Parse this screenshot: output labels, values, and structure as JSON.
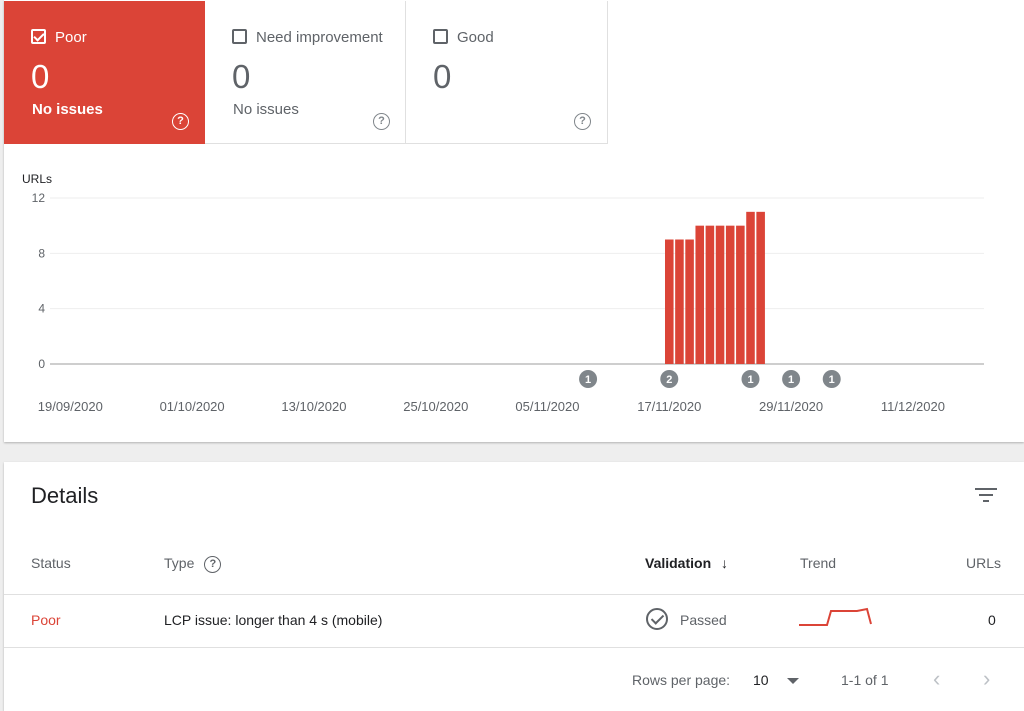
{
  "tiles": {
    "poor": {
      "label": "Poor",
      "count": "0",
      "sub": "No issues",
      "checked": true
    },
    "need": {
      "label": "Need improvement",
      "count": "0",
      "sub": "No issues",
      "checked": false
    },
    "good": {
      "label": "Good",
      "count": "0",
      "sub": "",
      "checked": false
    }
  },
  "help_glyph": "?",
  "colors": {
    "poor": "#db4437",
    "text_secondary": "#5f6368",
    "marker": "#80868b"
  },
  "chart_data": {
    "type": "bar",
    "ylabel": "URLs",
    "ylim": [
      0,
      12
    ],
    "yticks": [
      "12",
      "8",
      "4",
      "0"
    ],
    "x_range": [
      "2020-09-17",
      "2020-12-18"
    ],
    "xtick_labels": [
      "19/09/2020",
      "01/10/2020",
      "13/10/2020",
      "25/10/2020",
      "05/11/2020",
      "17/11/2020",
      "29/11/2020",
      "11/12/2020"
    ],
    "xtick_dates": [
      "2020-09-19",
      "2020-10-01",
      "2020-10-13",
      "2020-10-25",
      "2020-11-05",
      "2020-11-17",
      "2020-11-29",
      "2020-12-11"
    ],
    "series": [
      {
        "color": "#db4437",
        "x": [
          "2020-11-17",
          "2020-11-18",
          "2020-11-19",
          "2020-11-20",
          "2020-11-21",
          "2020-11-22",
          "2020-11-23",
          "2020-11-24",
          "2020-11-25",
          "2020-11-26"
        ],
        "values": [
          9,
          9,
          9,
          10,
          10,
          10,
          10,
          10,
          11,
          11
        ]
      }
    ],
    "annotations": [
      {
        "date": "2020-11-09",
        "label": "1"
      },
      {
        "date": "2020-11-17",
        "label": "2"
      },
      {
        "date": "2020-11-25",
        "label": "1"
      },
      {
        "date": "2020-11-29",
        "label": "1"
      },
      {
        "date": "2020-12-03",
        "label": "1"
      }
    ],
    "grid": true
  },
  "details": {
    "title": "Details",
    "columns": {
      "status": "Status",
      "type": "Type",
      "validation": "Validation",
      "validation_sort": "↓",
      "trend": "Trend",
      "urls": "URLs"
    },
    "rows": [
      {
        "status": "Poor",
        "type": "LCP issue: longer than 4 s (mobile)",
        "validation": "Passed",
        "urls": "0"
      }
    ],
    "footer": {
      "rows_per_page_label": "Rows per page:",
      "rows_per_page_value": "10",
      "range": "1-1 of 1",
      "prev": "‹",
      "next": "›"
    }
  }
}
